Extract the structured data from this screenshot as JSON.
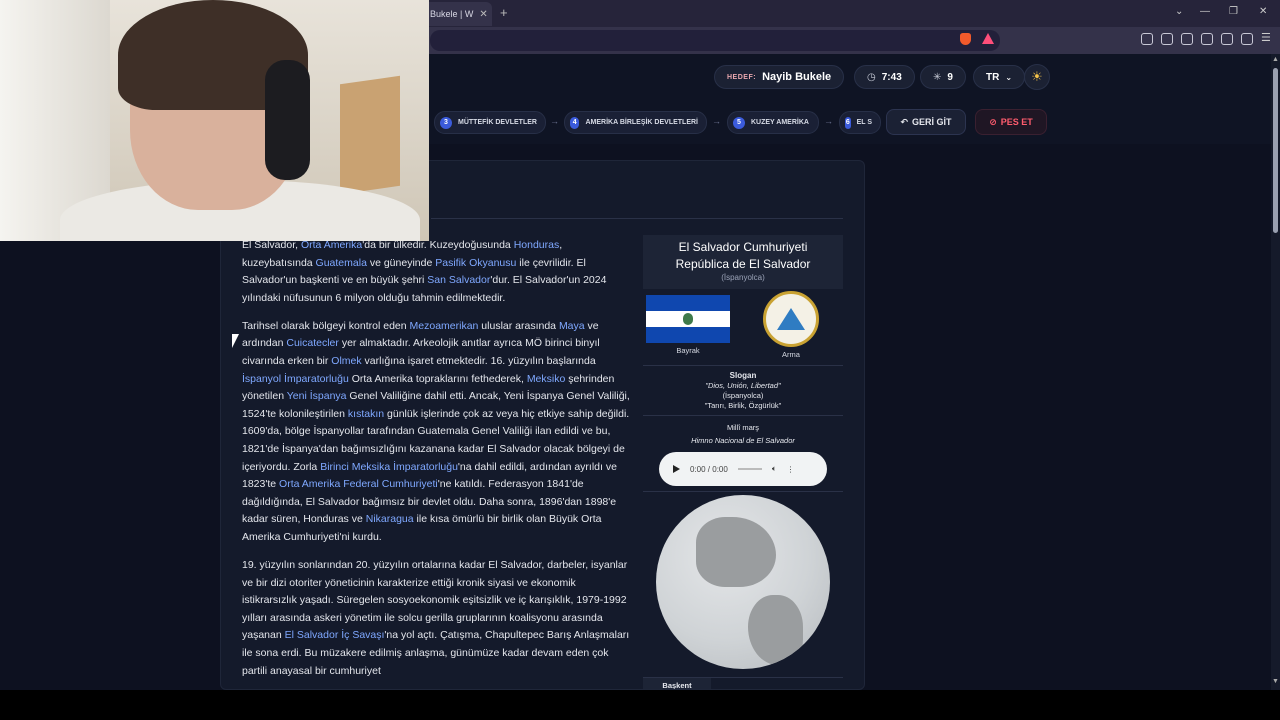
{
  "browser": {
    "tab_title": "Bukele | W",
    "tab_close": "✕",
    "new_tab": "+",
    "window_controls": [
      "⌄",
      "—",
      "❐",
      "✕"
    ]
  },
  "toolbar": {
    "target_label": "HEDEF:",
    "target_value": "Nayib Bukele",
    "timer": "7:43",
    "clicks": "9",
    "language": "TR",
    "breadcrumbs": [
      {
        "n": "3",
        "label": "MÜTTEFİK DEVLETLER"
      },
      {
        "n": "4",
        "label": "AMERİKA BİRLEŞİK DEVLETLERİ"
      },
      {
        "n": "5",
        "label": "KUZEY AMERİKA"
      },
      {
        "n": "6",
        "label": "EL S"
      }
    ],
    "back_label": "GERİ GİT",
    "giveup_label": "PES ET"
  },
  "article": {
    "p1": [
      {
        "t": "El Salvador, "
      },
      {
        "a": "Orta Amerika"
      },
      {
        "t": "'da bir ülkedir. Kuzeydoğusunda "
      },
      {
        "a": "Honduras"
      },
      {
        "t": ", kuzeybatısında "
      },
      {
        "a": "Guatemala"
      },
      {
        "t": " ve güneyinde "
      },
      {
        "a": "Pasifik Okyanusu"
      },
      {
        "t": " ile çevrilidir. El Salvador'un başkenti ve en büyük şehri "
      },
      {
        "a": "San Salvador"
      },
      {
        "t": "'dur. El Salvador'un 2024 yılındaki nüfusunun 6 milyon olduğu tahmin edilmektedir."
      }
    ],
    "p2": [
      {
        "t": "Tarihsel olarak bölgeyi kontrol eden "
      },
      {
        "a": "Mezoamerikan"
      },
      {
        "t": " uluslar arasında "
      },
      {
        "a": "Maya"
      },
      {
        "t": " ve ardından "
      },
      {
        "a": "Cuicatecler"
      },
      {
        "t": " yer almaktadır. Arkeolojik anıtlar ayrıca MÖ birinci binyıl civarında erken bir "
      },
      {
        "a": "Olmek"
      },
      {
        "t": " varlığına işaret etmektedir. 16. yüzyılın başlarında "
      },
      {
        "a": "İspanyol İmparatorluğu"
      },
      {
        "t": " Orta Amerika topraklarını fethederek, "
      },
      {
        "a": "Meksiko"
      },
      {
        "t": " şehrinden yönetilen "
      },
      {
        "a": "Yeni İspanya"
      },
      {
        "t": " Genel Valiliğine dahil etti. Ancak, Yeni İspanya Genel Valiliği, 1524'te kolonileştirilen "
      },
      {
        "a": "kıstakın"
      },
      {
        "t": " günlük işlerinde çok az veya hiç etkiye sahip değildi. 1609'da, bölge İspanyollar tarafından Guatemala Genel Valiliği ilan edildi ve bu, 1821'de İspanya'dan bağımsızlığını kazanana kadar El Salvador olacak bölgeyi de içeriyordu. Zorla "
      },
      {
        "a": "Birinci Meksika İmparatorluğu"
      },
      {
        "t": "'na dahil edildi, ardından ayrıldı ve 1823'te "
      },
      {
        "a": "Orta Amerika Federal Cumhuriyeti"
      },
      {
        "t": "'ne katıldı. Federasyon 1841'de dağıldığında, El Salvador bağımsız bir devlet oldu. Daha sonra, 1896'dan 1898'e kadar süren, Honduras ve "
      },
      {
        "a": "Nikaragua"
      },
      {
        "t": " ile kısa ömürlü bir birlik olan Büyük Orta Amerika Cumhuriyeti'ni kurdu."
      }
    ],
    "p3": [
      {
        "t": "19. yüzyılın sonlarından 20. yüzyılın ortalarına kadar El Salvador, darbeler, isyanlar ve bir dizi otoriter yöneticinin karakterize ettiği kronik siyasi ve ekonomik istikrarsızlık yaşadı. Süregelen sosyoekonomik eşitsizlik ve iç karışıklık, 1979-1992 yılları arasında askeri yönetim ile solcu gerilla gruplarının koalisyonu arasında yaşanan "
      },
      {
        "a": "El Salvador İç Savaşı"
      },
      {
        "t": "'na yol açtı. Çatışma, Chapultepec Barış Anlaşmaları ile sona erdi. Bu müzakere edilmiş anlaşma, günümüze kadar devam eden çok partili anayasal bir cumhuriyet"
      }
    ]
  },
  "infobox": {
    "name_tr": "El Salvador Cumhuriyeti",
    "name_es": "República de El Salvador",
    "lang_note": "(İspanyolca)",
    "flag_caption": "Bayrak",
    "arms_caption": "Arma",
    "motto_title": "Slogan",
    "motto_es": "\"Dios, Unión, Libertad\"",
    "motto_lang": "(İspanyolca)",
    "motto_tr": "\"Tanrı, Birlik, Özgürlük\"",
    "anthem_title": "Millî marş",
    "anthem_name": "Himno Nacional de El Salvador",
    "audio_time": "0:00 / 0:00",
    "capital_label": "Başkent"
  }
}
